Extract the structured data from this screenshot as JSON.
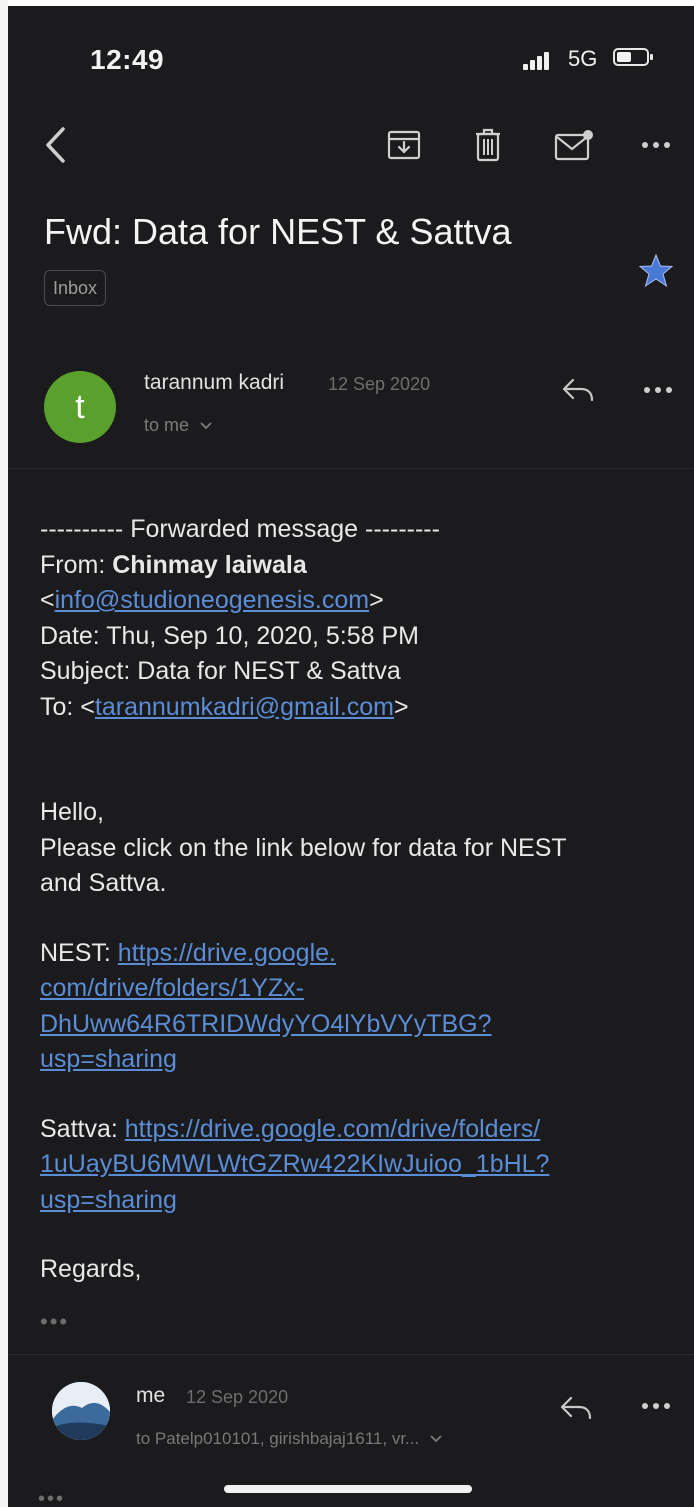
{
  "status": {
    "time": "12:49",
    "network": "5G"
  },
  "email": {
    "subject": "Fwd: Data for NEST & Sattva",
    "label": "Inbox",
    "message1": {
      "avatar_letter": "t",
      "sender": "tarannum kadri",
      "date": "12 Sep 2020",
      "recipients": "to me"
    },
    "body": {
      "forward_header": "---------- Forwarded message ---------",
      "from_label": "From: ",
      "from_name": "Chinmay laiwala",
      "from_email_open": "<",
      "from_email": "info@studioneogenesis.com",
      "from_email_close": ">",
      "date_line": "Date: Thu, Sep 10, 2020, 5:58 PM",
      "subject_line": "Subject: Data for NEST & Sattva",
      "to_label": "To: <",
      "to_email": "tarannumkadri@gmail.com",
      "to_close": ">",
      "greeting": "Hello,",
      "para1_line1": "Please click on the link below for data for NEST",
      "para1_line2": "and Sattva.",
      "nest_label": "NEST: ",
      "nest_url_1": "https://drive.google.",
      "nest_url_2": "com/drive/folders/1YZx-",
      "nest_url_3": "DhUww64R6TRIDWdyYO4lYbVYyTBG?",
      "nest_url_4": "usp=sharing",
      "sattva_label": "Sattva: ",
      "sattva_url_1": "https://drive.google.com/drive/folders/",
      "sattva_url_2": "1uUayBU6MWLWtGZRw422KIwJuioo_1bHL?",
      "sattva_url_3": "usp=sharing",
      "regards": "Regards,",
      "trimmed": "•••"
    },
    "message2": {
      "sender": "me",
      "date": "12 Sep 2020",
      "recipients": "to Patelp010101, girishbajaj1611, vr...",
      "trimmed": "•••"
    }
  },
  "icons": {
    "back": "chevron-left-icon",
    "archive": "archive-icon",
    "trash": "trash-icon",
    "mark_unread": "mail-unread-icon",
    "more": "more-horizontal-icon",
    "star": "star-icon",
    "reply": "reply-icon"
  },
  "colors": {
    "background": "#1b1b1d",
    "link": "#5b8dd6",
    "avatar": "#5aa02c",
    "star": "#4a78d6"
  }
}
